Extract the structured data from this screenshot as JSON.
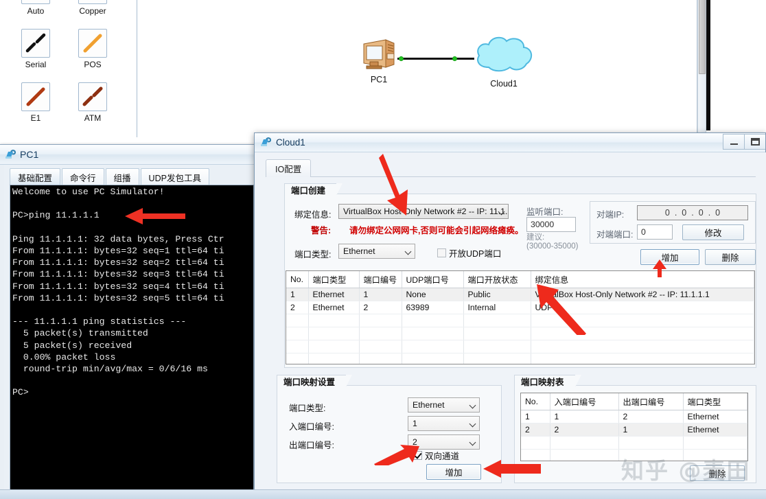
{
  "palette": {
    "items": [
      {
        "label": "Auto",
        "icon": "lightning-link-icon",
        "color": "#1a1a1a"
      },
      {
        "label": "Copper",
        "icon": "copper-link-icon",
        "color": "#111111"
      },
      {
        "label": "Serial",
        "icon": "serial-link-icon",
        "color": "#1a1a1a"
      },
      {
        "label": "POS",
        "icon": "pos-link-icon",
        "color": "#f0a030"
      },
      {
        "label": "E1",
        "icon": "e1-link-icon",
        "color": "#b03a12"
      },
      {
        "label": "ATM",
        "icon": "atm-link-icon",
        "color": "#8d2f10"
      }
    ]
  },
  "topology": {
    "pc_label": "PC1",
    "cloud_label": "Cloud1"
  },
  "pc1_window": {
    "title": "PC1",
    "icon": "pc-device-icon",
    "tabs": [
      {
        "label": "基础配置",
        "active": false
      },
      {
        "label": "命令行",
        "active": true
      },
      {
        "label": "组播",
        "active": false
      },
      {
        "label": "UDP发包工具",
        "active": false
      }
    ],
    "terminal": "Welcome to use PC Simulator!\n\nPC>ping 11.1.1.1\n\nPing 11.1.1.1: 32 data bytes, Press Ctr\nFrom 11.1.1.1: bytes=32 seq=1 ttl=64 ti\nFrom 11.1.1.1: bytes=32 seq=2 ttl=64 ti\nFrom 11.1.1.1: bytes=32 seq=3 ttl=64 ti\nFrom 11.1.1.1: bytes=32 seq=4 ttl=64 ti\nFrom 11.1.1.1: bytes=32 seq=5 ttl=64 ti\n\n--- 11.1.1.1 ping statistics ---\n  5 packet(s) transmitted\n  5 packet(s) received\n  0.00% packet loss\n  round-trip min/avg/max = 0/6/16 ms\n\nPC>"
  },
  "cloud1_dialog": {
    "title": "Cloud1",
    "icon": "cloud-device-icon",
    "window_buttons": {
      "minimize": "minimize-icon",
      "maximize": "maximize-icon"
    },
    "tab_label": "IO配置",
    "port_create": {
      "group_title": "端口创建",
      "bind_info_label": "绑定信息:",
      "bind_info_value": "VirtualBox Host-Only Network #2 -- IP: 11.1.1.",
      "warning_label": "警告:",
      "warning_text": "请勿绑定公网网卡,否则可能会引起网络瘫痪。",
      "port_type_label": "端口类型:",
      "port_type_value": "Ethernet",
      "udp_checkbox_label": "开放UDP端口",
      "udp_checkbox_checked": false,
      "listen_port_label": "监听端口:",
      "listen_port_value": "30000",
      "suggest_label": "建议:",
      "suggest_range": "(30000-35000)",
      "peer_ip_label": "对端IP:",
      "peer_ip_octets": [
        "0",
        "0",
        "0",
        "0"
      ],
      "peer_port_label": "对端端口:",
      "peer_port_value": "0",
      "modify_button": "修改",
      "add_button": "增加",
      "delete_button": "删除",
      "table": {
        "columns": [
          "No.",
          "端口类型",
          "端口编号",
          "UDP端口号",
          "端口开放状态",
          "绑定信息"
        ],
        "rows": [
          [
            "1",
            "Ethernet",
            "1",
            "None",
            "Public",
            "VirtualBox Host-Only Network #2 -- IP: 11.1.1.1"
          ],
          [
            "2",
            "Ethernet",
            "2",
            "63989",
            "Internal",
            "UDP"
          ]
        ],
        "blank_rows": 4
      }
    },
    "port_mapping_settings": {
      "group_title": "端口映射设置",
      "port_type_label": "端口类型:",
      "port_type_value": "Ethernet",
      "in_port_label": "入端口编号:",
      "in_port_value": "1",
      "out_port_label": "出端口编号:",
      "out_port_value": "2",
      "bidirectional_label": "双向通道",
      "bidirectional_checked": true,
      "add_button": "增加"
    },
    "port_mapping_table": {
      "group_title": "端口映射表",
      "columns": [
        "No.",
        "入端口编号",
        "出端口编号",
        "端口类型"
      ],
      "rows": [
        [
          "1",
          "1",
          "2",
          "Ethernet"
        ],
        [
          "2",
          "2",
          "1",
          "Ethernet"
        ]
      ],
      "blank_rows": 3,
      "delete_button": "删除"
    }
  },
  "watermark": {
    "text": "知乎 @麦田"
  },
  "colors": {
    "accent": "#2c6ca8",
    "arrow_red": "#ee1c1c",
    "warning_red": "#d00000",
    "link_green": "#23c423"
  }
}
